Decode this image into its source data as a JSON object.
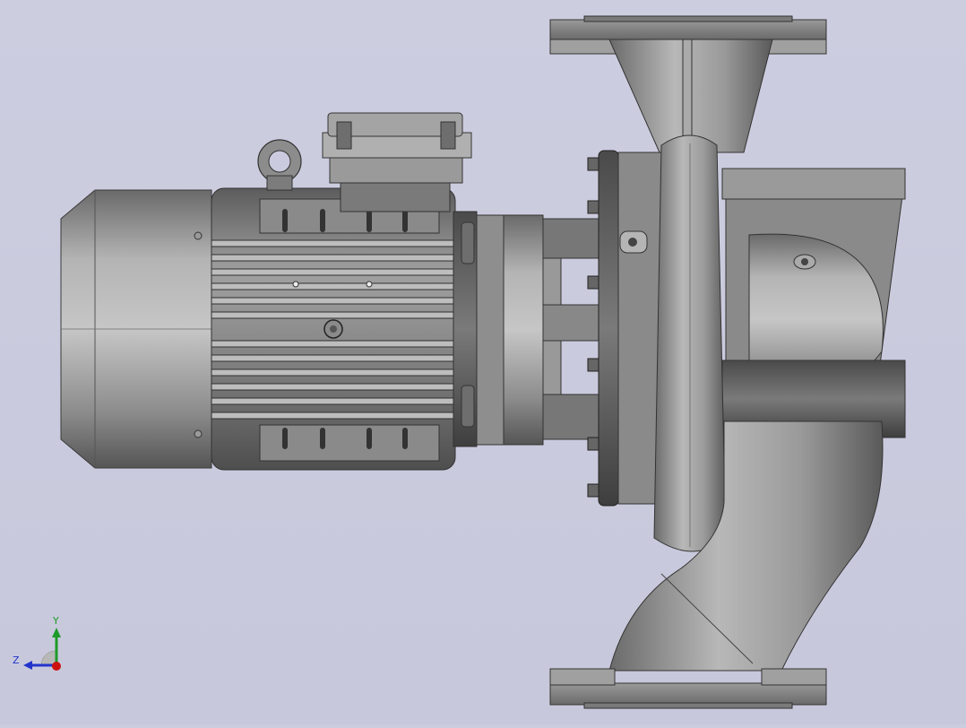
{
  "viewport": {
    "background": "#cbcbdf",
    "model_name": "centrifugal-pump-assembly",
    "model_color": "#8e8e8e"
  },
  "triad": {
    "y_label": "Y",
    "z_label": "Z",
    "y_color": "#1e9a2a",
    "z_color": "#2233cc",
    "x_color": "#cc1111"
  }
}
